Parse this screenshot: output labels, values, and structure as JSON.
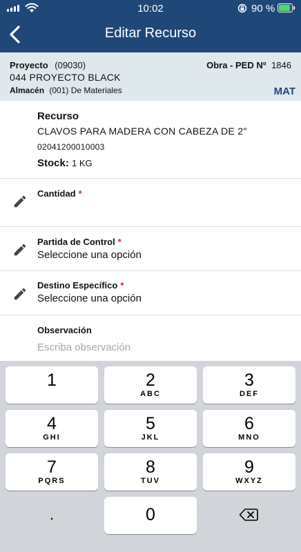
{
  "status_bar": {
    "time": "10:02",
    "battery_pct": "90 %",
    "battery_color": "#4cd964",
    "icons": [
      "signal-icon",
      "wifi-icon",
      "rotation-lock-icon",
      "battery-icon"
    ]
  },
  "nav": {
    "title": "Editar Recurso",
    "back_icon": "chevron-left-icon"
  },
  "project": {
    "label": "Proyecto",
    "code": "(09030)",
    "name": "044 PROYECTO BLACK",
    "obra_label": "Obra - PED Nº",
    "obra_value": "1846",
    "almacen_label": "Almacén",
    "almacen_value": "(001) De Materiales",
    "mat": "MAT"
  },
  "resource": {
    "label": "Recurso",
    "description": "CLAVOS PARA MADERA CON CABEZA DE 2\"",
    "code": "02041200010003",
    "stock_label": "Stock:",
    "stock_value": "1 KG"
  },
  "fields": {
    "cantidad": {
      "label": "Cantidad",
      "required": "*",
      "value": ""
    },
    "partida": {
      "label": "Partida de Control",
      "required": "*",
      "value": "Seleccione una opción"
    },
    "destino": {
      "label": "Destino Específico",
      "required": "*",
      "value": "Seleccione una opción"
    },
    "observacion": {
      "label": "Observación",
      "placeholder": "Escriba observación"
    }
  },
  "keyboard": {
    "keys": [
      {
        "num": "1",
        "letters": ""
      },
      {
        "num": "2",
        "letters": "ABC"
      },
      {
        "num": "3",
        "letters": "DEF"
      },
      {
        "num": "4",
        "letters": "GHI"
      },
      {
        "num": "5",
        "letters": "JKL"
      },
      {
        "num": "6",
        "letters": "MNO"
      },
      {
        "num": "7",
        "letters": "PQRS"
      },
      {
        "num": "8",
        "letters": "TUV"
      },
      {
        "num": "9",
        "letters": "WXYZ"
      },
      {
        "num": ".",
        "letters": ""
      },
      {
        "num": "0",
        "letters": ""
      }
    ],
    "delete_icon": "backspace-icon"
  },
  "colors": {
    "primary": "#1f4878",
    "info_bg": "#dfe8ed",
    "required": "#e02020",
    "keyboard_bg": "#d1d4d9"
  }
}
